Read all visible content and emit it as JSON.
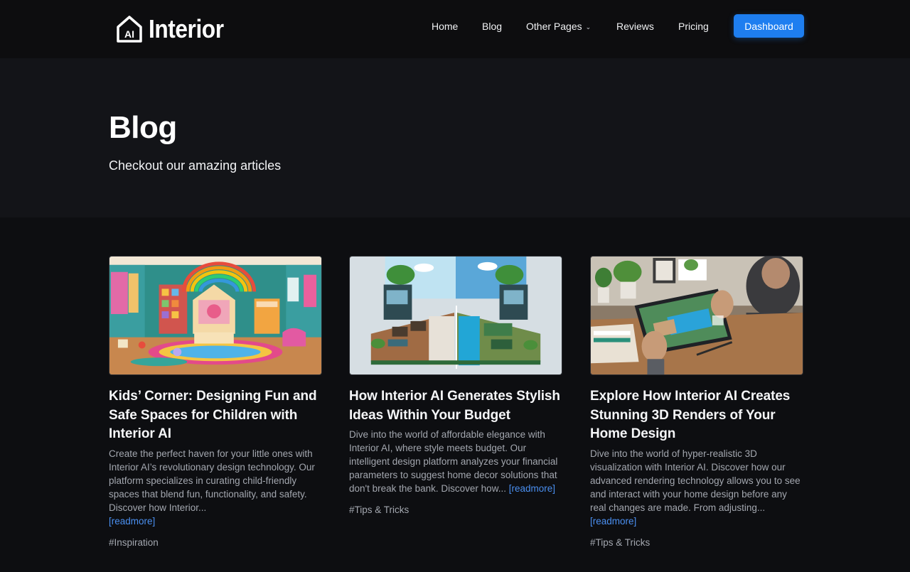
{
  "brand": {
    "name": "Interior",
    "badge": "AI"
  },
  "nav": {
    "items": [
      {
        "label": "Home"
      },
      {
        "label": "Blog"
      },
      {
        "label": "Other Pages"
      },
      {
        "label": "Reviews"
      },
      {
        "label": "Pricing"
      }
    ],
    "cta": "Dashboard"
  },
  "hero": {
    "title": "Blog",
    "subtitle": "Checkout our amazing articles"
  },
  "posts": [
    {
      "title": "Kids’ Corner: Designing Fun and Safe Spaces for Children with Interior AI",
      "excerpt": "Create the perfect haven for your little ones with Interior AI’s revolutionary design technology. Our platform specializes in curating child-friendly spaces that blend fun, functionality, and safety. Discover how Interior...",
      "readmore": "[readmore]",
      "tag": "#Inspiration"
    },
    {
      "title": "How Interior AI Generates Stylish Ideas Within Your Budget",
      "excerpt": "Dive into the world of affordable elegance with Interior AI, where style meets budget. Our intelligent design platform analyzes your financial parameters to suggest home decor solutions that don't break the bank. Discover how...",
      "readmore": "[readmore]",
      "tag": "#Tips & Tricks"
    },
    {
      "title": "Explore How Interior AI Creates Stunning 3D Renders of Your Home Design",
      "excerpt": "Dive into the world of hyper-realistic 3D visualization with Interior AI. Discover how our advanced rendering technology allows you to see and interact with your home design before any real changes are made. From adjusting...",
      "readmore": "[readmore]",
      "tag": "#Tips & Tricks"
    }
  ],
  "colors": {
    "accent": "#1e7ef0",
    "link": "#4a8ff0",
    "background": "#0d0e11",
    "hero_bg": "#131418"
  }
}
